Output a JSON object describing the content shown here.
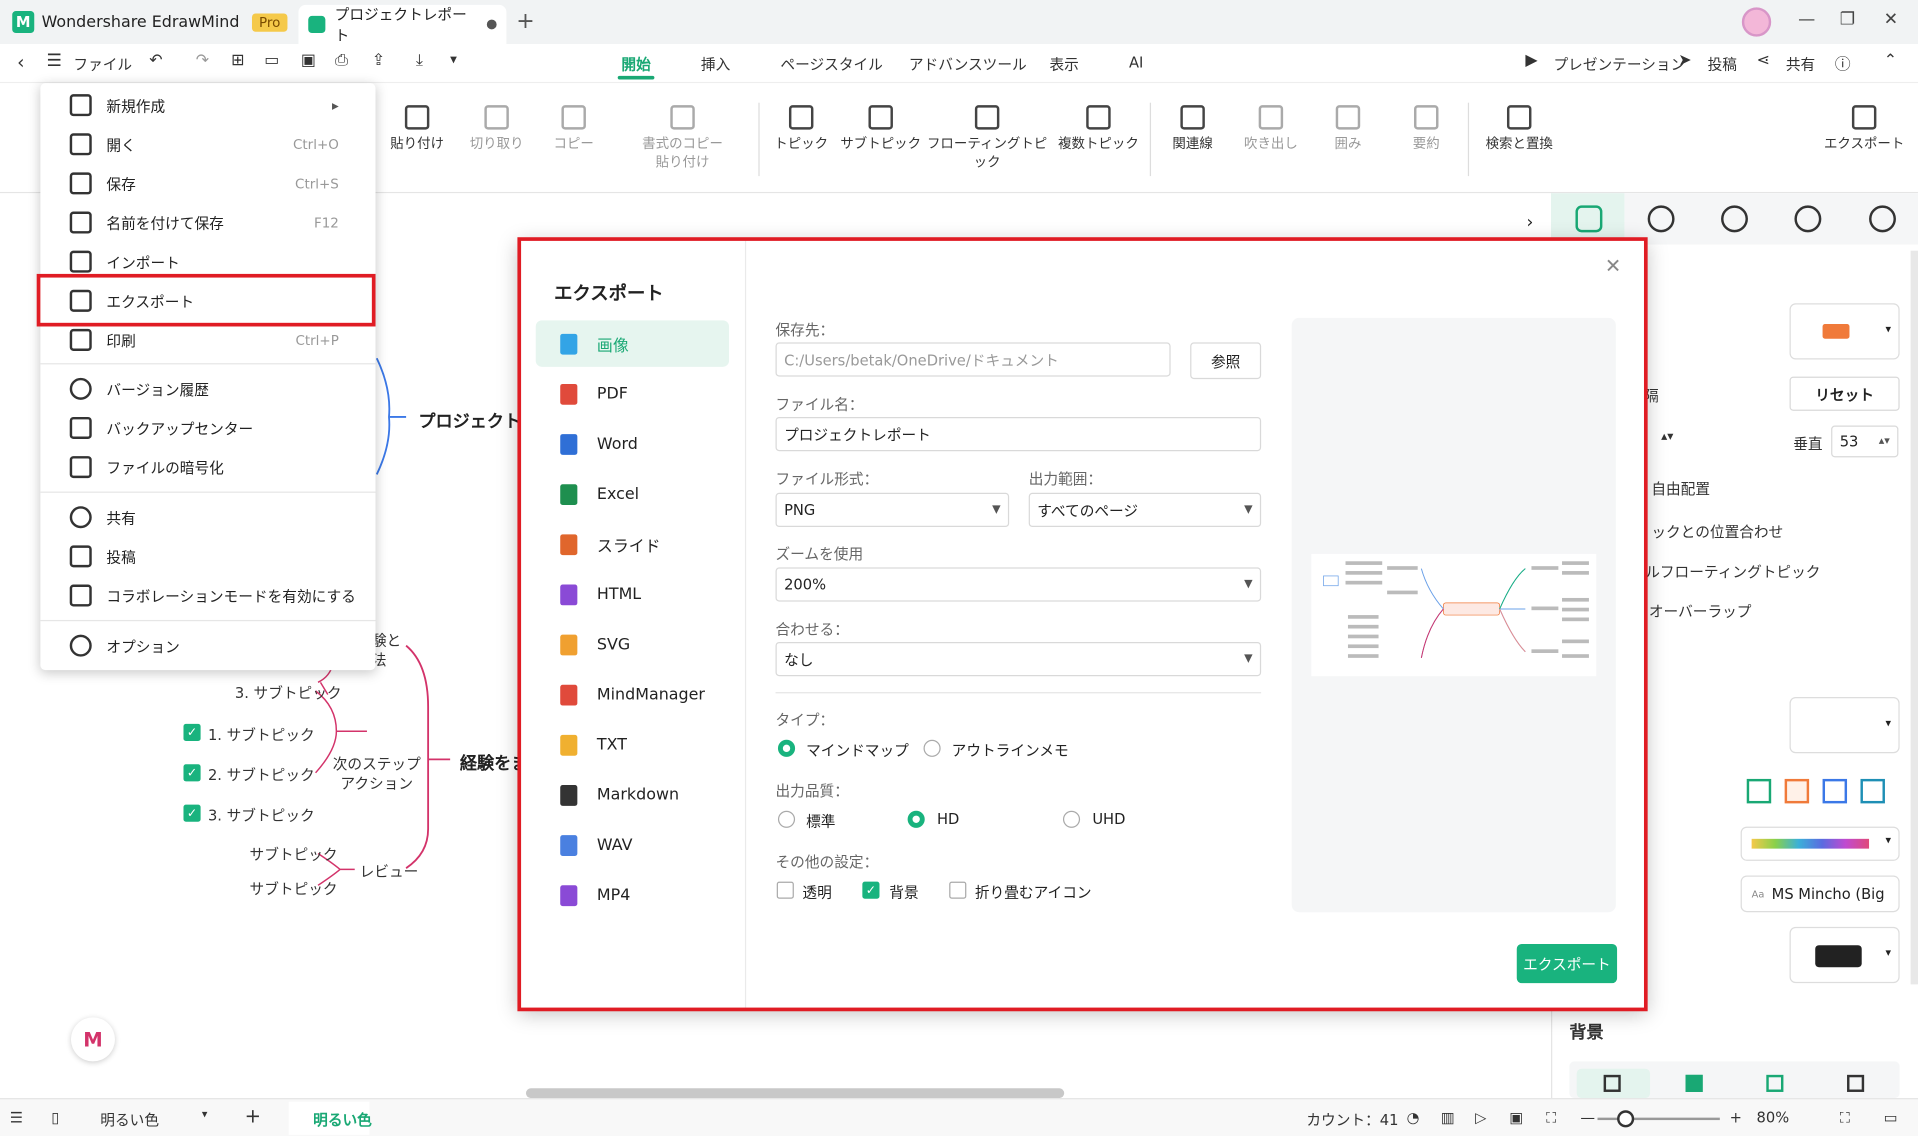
{
  "app": {
    "name": "Wondershare EdrawMind",
    "badge": "Pro",
    "doc_tab": "プロジェクトレポート"
  },
  "menubar": {
    "file": "ファイル",
    "tabs": [
      "開始",
      "挿入",
      "ページスタイル",
      "アドバンスツール",
      "表示",
      "AI"
    ],
    "active_tab": "開始",
    "right": [
      "プレゼンテーション",
      "投稿",
      "共有"
    ]
  },
  "ribbon": {
    "buttons": [
      {
        "label": "貼り付け",
        "disabled": false
      },
      {
        "label": "切り取り",
        "disabled": true
      },
      {
        "label": "コピー",
        "disabled": true
      },
      {
        "label": "書式のコピー\n貼り付け",
        "disabled": true
      },
      {
        "label": "トピック",
        "disabled": false
      },
      {
        "label": "サブトピック",
        "disabled": false
      },
      {
        "label": "フローティングトピック",
        "disabled": false
      },
      {
        "label": "複数トピック",
        "disabled": false
      },
      {
        "label": "関連線",
        "disabled": false
      },
      {
        "label": "吹き出し",
        "disabled": true
      },
      {
        "label": "囲み",
        "disabled": true
      },
      {
        "label": "要約",
        "disabled": true
      },
      {
        "label": "検索と置換",
        "disabled": false
      },
      {
        "label": "エクスポート",
        "disabled": false
      }
    ]
  },
  "file_menu": {
    "items": [
      {
        "label": "新規作成",
        "shortcut": ""
      },
      {
        "label": "開く",
        "shortcut": "Ctrl+O"
      },
      {
        "label": "保存",
        "shortcut": "Ctrl+S"
      },
      {
        "label": "名前を付けて保存",
        "shortcut": "F12"
      },
      {
        "label": "インポート",
        "shortcut": ""
      },
      {
        "label": "エクスポート",
        "shortcut": ""
      },
      {
        "label": "印刷",
        "shortcut": "Ctrl+P"
      },
      {
        "label": "バージョン履歴",
        "shortcut": ""
      },
      {
        "label": "バックアップセンター",
        "shortcut": ""
      },
      {
        "label": "ファイルの暗号化",
        "shortcut": ""
      },
      {
        "label": "共有",
        "shortcut": ""
      },
      {
        "label": "投稿",
        "shortcut": ""
      },
      {
        "label": "コラボレーションモードを有効にする",
        "shortcut": ""
      },
      {
        "label": "オプション",
        "shortcut": ""
      }
    ]
  },
  "canvas": {
    "topic1": "プロジェクトの",
    "topic2": "経験をま",
    "subtopics": [
      "3. サブトピック",
      "1. サブトピック",
      "2. サブトピック",
      "3. サブトピック",
      "サブトピック",
      "サブトピック"
    ],
    "next_step": "次のステップ\nアクション",
    "review": "レビュー",
    "partial": "験と\n法"
  },
  "dialog": {
    "title": "エクスポート",
    "formats": [
      "画像",
      "PDF",
      "Word",
      "Excel",
      "スライド",
      "HTML",
      "SVG",
      "MindManager",
      "TXT",
      "Markdown",
      "WAV",
      "MP4"
    ],
    "format_colors": [
      "#33a4e6",
      "#e04a3b",
      "#2f6fd6",
      "#1e8f4f",
      "#e0662c",
      "#8a4ad6",
      "#f0a030",
      "#e04a3b",
      "#f0b030",
      "#333333",
      "#4a80e0",
      "#8a4ad6"
    ],
    "save_to_label": "保存先：",
    "save_to_value": "C:/Users/betak/OneDrive/ドキュメント",
    "browse": "参照",
    "filename_label": "ファイル名：",
    "filename_value": "プロジェクトレポート",
    "format_label": "ファイル形式：",
    "format_value": "PNG",
    "range_label": "出力範囲：",
    "range_value": "すべてのページ",
    "zoom_label": "ズームを使用",
    "zoom_value": "200%",
    "fit_label": "合わせる：",
    "fit_value": "なし",
    "type_label": "タイプ：",
    "type_opts": [
      "マインドマップ",
      "アウトラインメモ"
    ],
    "quality_label": "出力品質：",
    "quality_opts": [
      "標準",
      "HD",
      "UHD"
    ],
    "other_label": "その他の設定：",
    "other_opts": [
      "透明",
      "背景",
      "折り畳むアイコン"
    ],
    "export_btn": "エクスポート"
  },
  "rpanel": {
    "reset": "リセット",
    "vertical": "垂直",
    "vertical_value": "53",
    "free": "自由配置",
    "align": "ックとの位置合わせ",
    "floating": "ルフローティングトピック",
    "overlap": "オーバーラップ",
    "font": "MS Mincho (Big",
    "bg": "背景",
    "partial": "隔"
  },
  "status": {
    "theme": "明るい色",
    "theme2": "明るい色",
    "count": "カウント：41",
    "zoom": "80%"
  }
}
